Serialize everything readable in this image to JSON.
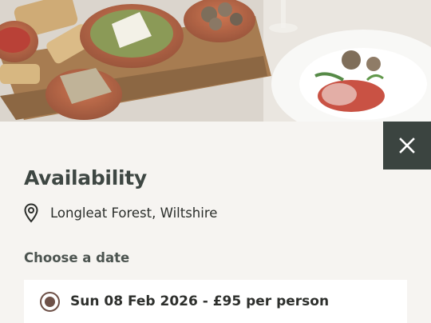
{
  "hero": {
    "image": "tapas-food-photo"
  },
  "close_button": {
    "icon": "close-icon"
  },
  "availability": {
    "title": "Availability",
    "location": {
      "icon": "location-pin-icon",
      "text": "Longleat Forest, Wiltshire"
    },
    "choose_date_label": "Choose a date",
    "date_options": [
      {
        "label": "Sun 08 Feb 2026 - £95 per person",
        "selected": true
      }
    ]
  },
  "colors": {
    "close_bg": "#3b4440",
    "radio": "#6e5148",
    "page_bg": "#f6f4f1"
  }
}
